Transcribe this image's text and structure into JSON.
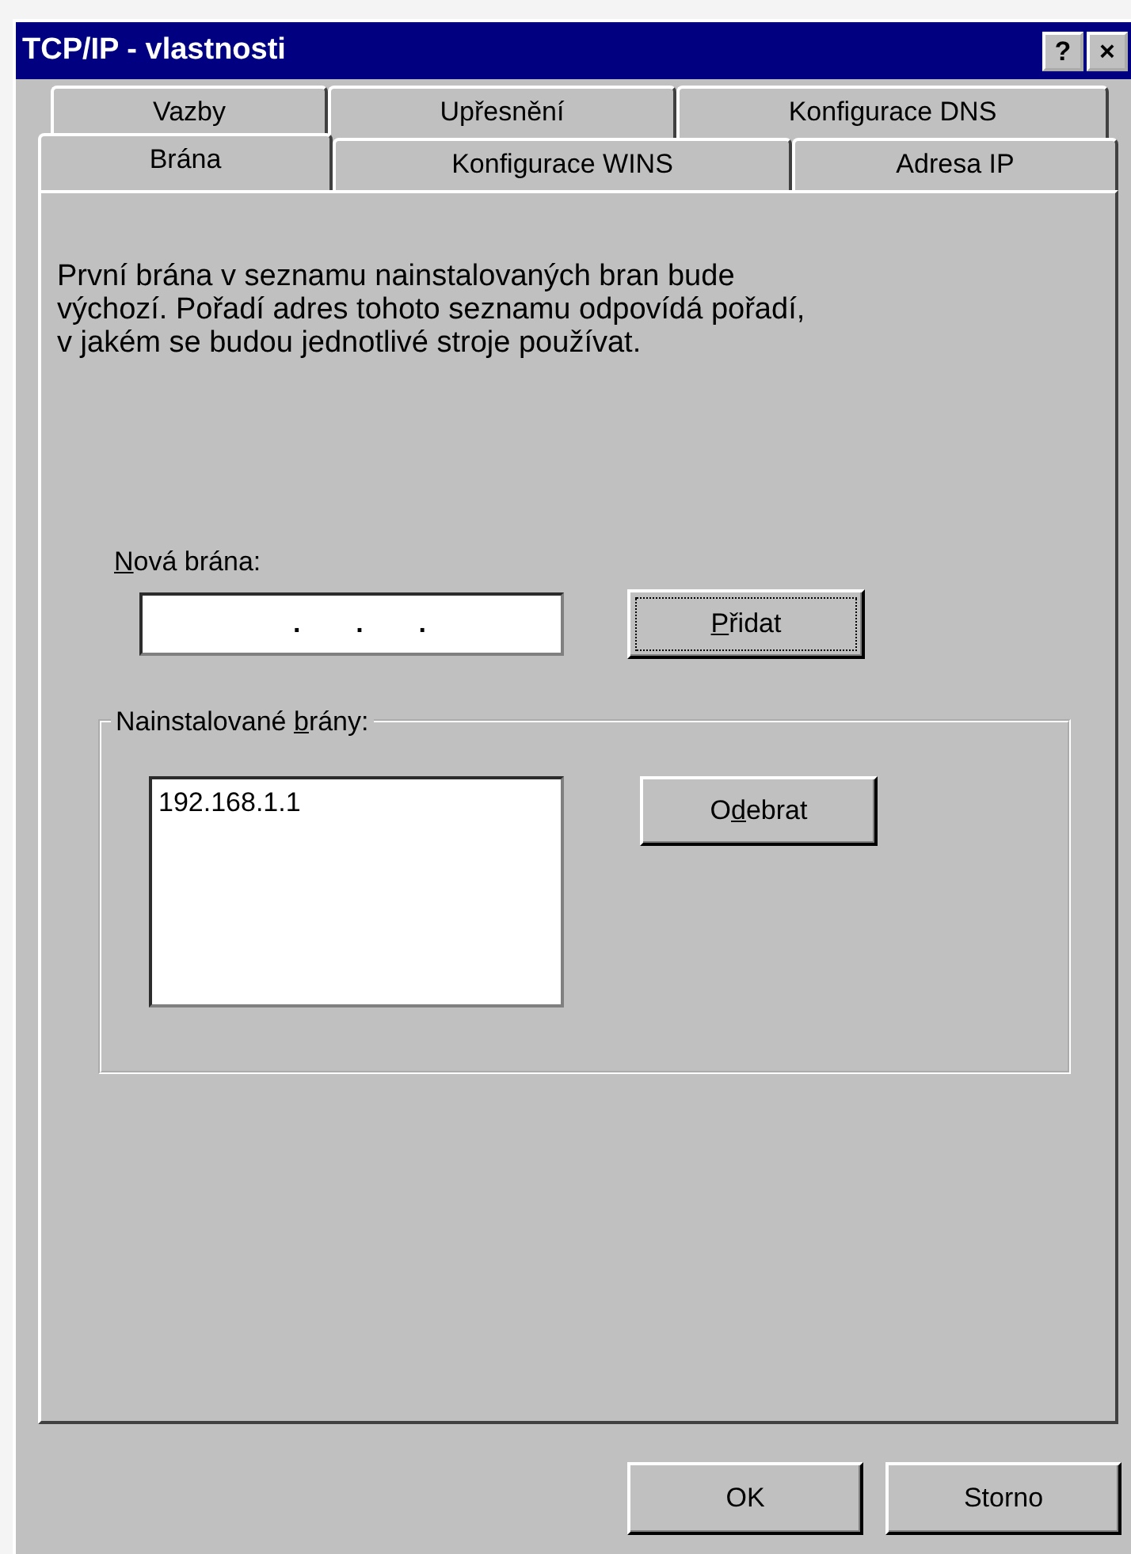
{
  "window": {
    "title": "TCP/IP - vlastnosti",
    "title_buttons": [
      "?",
      "×"
    ]
  },
  "tab_rows": [
    [
      {
        "label": "Vazby",
        "selected": false
      },
      {
        "label": "Upřesnění",
        "selected": false
      },
      {
        "label": "Konfigurace DNS",
        "selected": false
      }
    ],
    [
      {
        "label": "Brána",
        "selected": true
      },
      {
        "label": "Konfigurace WINS",
        "selected": false
      },
      {
        "label": "Adresa IP",
        "selected": false
      }
    ]
  ],
  "description": "První brána v seznamu nainstalovaných bran bude výchozí. Pořadí adres tohoto seznamu odpovídá pořadí, v jakém se budou jednotlivé stroje používat.",
  "new_gateway": {
    "label": {
      "key": "N",
      "post": "ová brána:"
    },
    "dots": [
      ".",
      ".",
      "."
    ],
    "button": {
      "label": {
        "key": "P",
        "post": "řidat"
      },
      "focused": true
    }
  },
  "installed": {
    "legend": {
      "pre": "Nainstalované ",
      "key": "b",
      "post": "rány:"
    },
    "items": [
      {
        "label": "192.168.1.1",
        "selected": false
      }
    ],
    "button": {
      "label": {
        "pre": "O",
        "key": "d",
        "post": "ebrat"
      },
      "focused": false
    }
  },
  "buttons": [
    "OK",
    "Storno"
  ]
}
